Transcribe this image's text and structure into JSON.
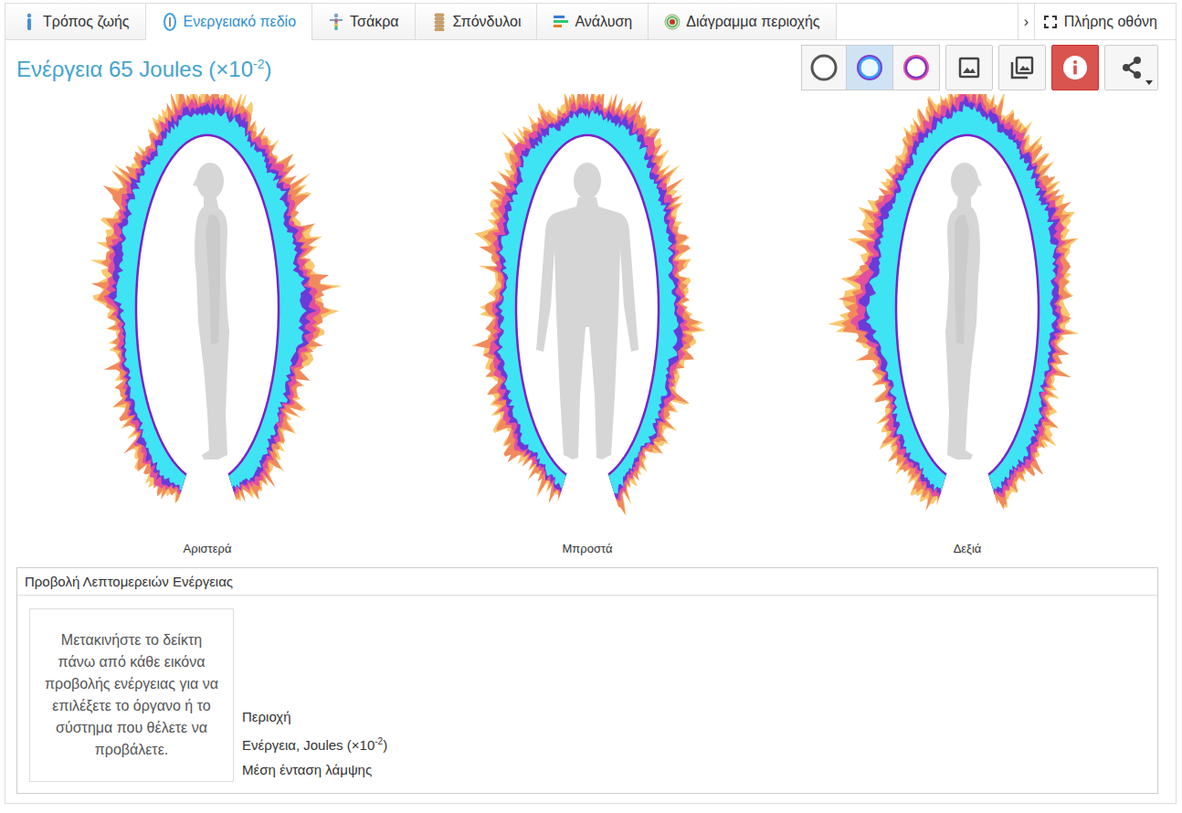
{
  "tabs": [
    {
      "label": "Τρόπος ζωής",
      "selected": false
    },
    {
      "label": "Ενεργειακό πεδίο",
      "selected": true
    },
    {
      "label": "Τσάκρα",
      "selected": false
    },
    {
      "label": "Σπόνδυλοι",
      "selected": false
    },
    {
      "label": "Ανάλυση",
      "selected": false
    },
    {
      "label": "Διάγραμμα περιοχής",
      "selected": false
    }
  ],
  "tab_scroll": "›",
  "fullscreen": {
    "label": "Πλήρης οθόνη"
  },
  "title": {
    "text": "Ενέργεια 65 Joules (×10",
    "sup": "-2",
    "close": ")"
  },
  "view_modes": [
    {
      "kind": "plain",
      "selected": false
    },
    {
      "kind": "glow",
      "selected": true
    },
    {
      "kind": "ring",
      "selected": false
    }
  ],
  "figures": [
    {
      "kind": "left",
      "caption": "Αριστερά"
    },
    {
      "kind": "front",
      "caption": "Μπροστά"
    },
    {
      "kind": "right",
      "caption": "Δεξιά"
    }
  ],
  "details_panel": {
    "title": "Προβολή Λεπτομερειών Ενέργειας",
    "hint": "Μετακινήστε το δείκτη πάνω από κάθε εικόνα προβολής ενέργειας για να επιλέξετε το όργανο ή το σύστημα που θέλετε να προβάλετε.",
    "fields": [
      {
        "label": "Περιοχή",
        "sup": "",
        "close": ""
      },
      {
        "label": "Ενέργεια, Joules (×10",
        "sup": "-2",
        "close": ")"
      },
      {
        "label": "Μέση ένταση λάμψης",
        "sup": "",
        "close": ""
      }
    ]
  }
}
